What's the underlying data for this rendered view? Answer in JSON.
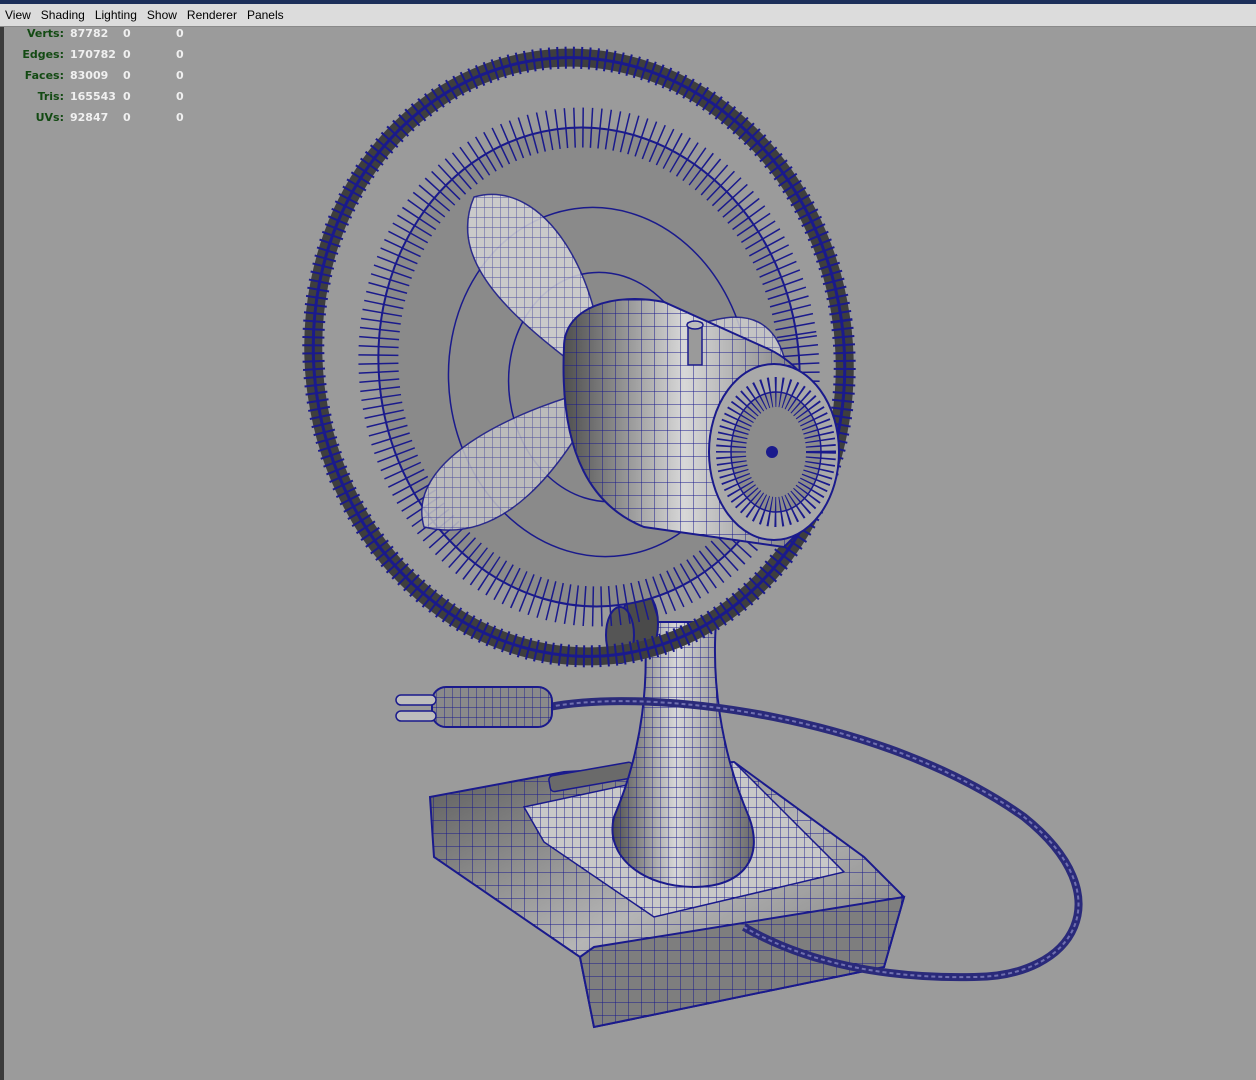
{
  "menu": [
    "View",
    "Shading",
    "Lighting",
    "Show",
    "Renderer",
    "Panels"
  ],
  "hud": {
    "rows": [
      {
        "label": "Verts:",
        "values": [
          "87782",
          "0",
          "0"
        ]
      },
      {
        "label": "Edges:",
        "values": [
          "170782",
          "0",
          "0"
        ]
      },
      {
        "label": "Faces:",
        "values": [
          "83009",
          "0",
          "0"
        ]
      },
      {
        "label": "Tris:",
        "values": [
          "165543",
          "0",
          "0"
        ]
      },
      {
        "label": "UVs:",
        "values": [
          "92847",
          "0",
          "0"
        ]
      }
    ]
  },
  "colors": {
    "viewport_bg": "#9b9b9b",
    "wireframe": "#1a1a8c",
    "hud_label": "#134a13",
    "hud_value": "#f0f0f0"
  }
}
